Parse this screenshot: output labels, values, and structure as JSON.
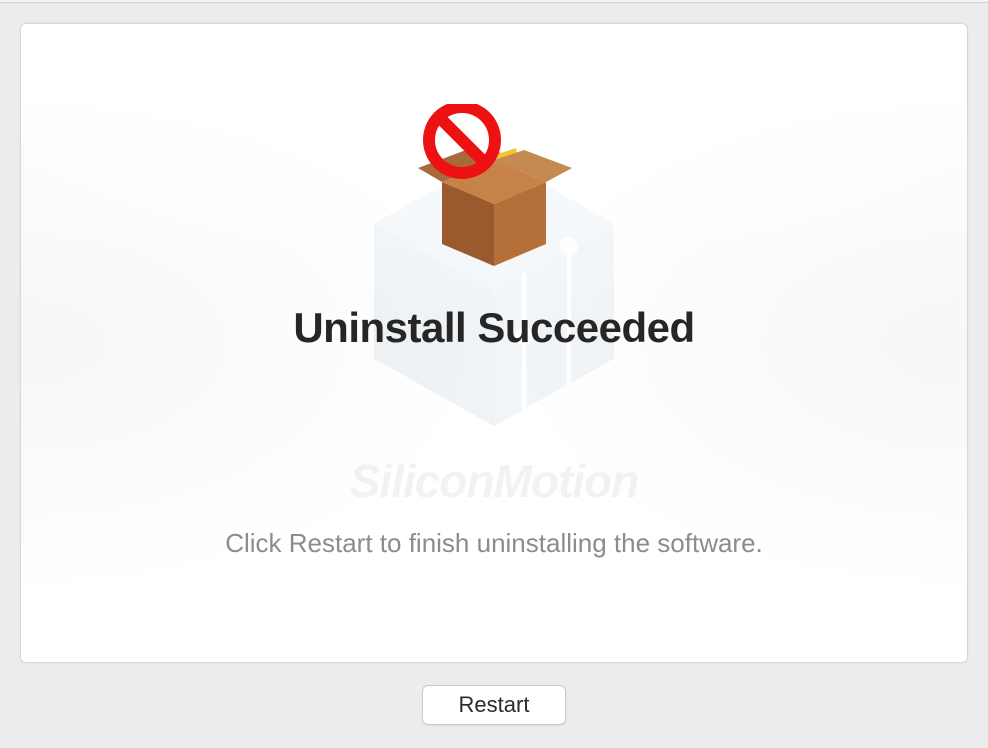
{
  "main": {
    "heading": "Uninstall Succeeded",
    "instruction": "Click Restart to finish uninstalling the software.",
    "watermark_brand": "SiliconMotion"
  },
  "footer": {
    "restart_label": "Restart"
  }
}
